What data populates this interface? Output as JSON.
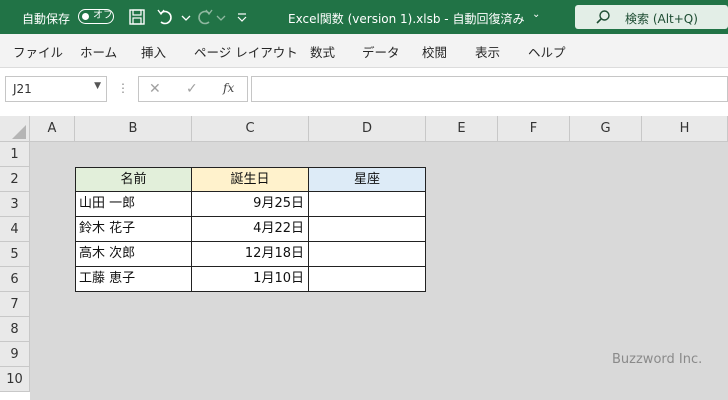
{
  "titlebar": {
    "autosave_label": "自動保存",
    "toggle_text": "オフ",
    "file_title": "Excel関数 (version 1).xlsb  -  自動回復済み",
    "search_label": "検索 (Alt+Q)",
    "bg_color": "#217346"
  },
  "ribbon_tabs": [
    "ファイル",
    "ホーム",
    "挿入",
    "ページ レイアウト",
    "数式",
    "データ",
    "校閲",
    "表示",
    "ヘルプ"
  ],
  "formula_bar": {
    "name_box": "J21",
    "fx_label": "fx",
    "formula": ""
  },
  "columns": [
    "A",
    "B",
    "C",
    "D",
    "E",
    "F",
    "G",
    "H"
  ],
  "rows": [
    "1",
    "2",
    "3",
    "4",
    "5",
    "6",
    "7",
    "8",
    "9",
    "10"
  ],
  "table": {
    "headers": {
      "name": "名前",
      "birthday": "誕生日",
      "sign": "星座"
    },
    "header_colors": {
      "name": "#e2efda",
      "birthday": "#fff2cc",
      "sign": "#ddebf7"
    },
    "rows": [
      {
        "name": "山田 一郎",
        "birthday": "9月25日",
        "sign": ""
      },
      {
        "name": "鈴木 花子",
        "birthday": "4月22日",
        "sign": ""
      },
      {
        "name": "高木 次郎",
        "birthday": "12月18日",
        "sign": ""
      },
      {
        "name": "工藤 恵子",
        "birthday": "1月10日",
        "sign": ""
      }
    ]
  },
  "watermark": "Buzzword Inc."
}
